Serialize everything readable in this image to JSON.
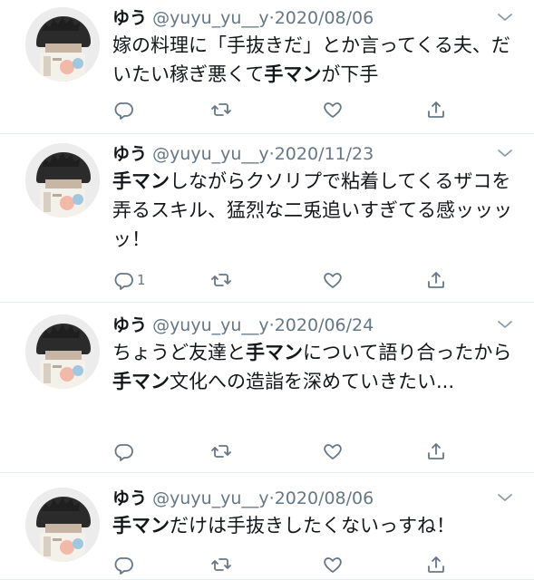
{
  "tweets": [
    {
      "name": "ゆう",
      "handle": "@yuyu_yu__y",
      "separator": "·",
      "date": "2020/08/06",
      "segments": [
        {
          "text": "嫁の料理に「手抜きだ」とか言ってくる夫、だいたい稼ぎ悪くて",
          "bold": false
        },
        {
          "text": "手マン",
          "bold": true
        },
        {
          "text": "が下手",
          "bold": false
        }
      ],
      "reply_count": ""
    },
    {
      "name": "ゆう",
      "handle": "@yuyu_yu__y",
      "separator": "·",
      "date": "2020/11/23",
      "segments": [
        {
          "text": "手マン",
          "bold": true
        },
        {
          "text": "しながらクソリプで粘着してくるザコを弄るスキル、猛烈な二兎追いすぎてる感ッッッッ！",
          "bold": false
        }
      ],
      "reply_count": "1"
    },
    {
      "name": "ゆう",
      "handle": "@yuyu_yu__y",
      "separator": "·",
      "date": "2020/06/24",
      "segments": [
        {
          "text": "ちょうど友達と",
          "bold": false
        },
        {
          "text": "手マン",
          "bold": true
        },
        {
          "text": "について語り合ったから",
          "bold": false
        },
        {
          "text": "手マン",
          "bold": true
        },
        {
          "text": "文化への造詣を深めていきたい...",
          "bold": false
        }
      ],
      "reply_count": ""
    },
    {
      "name": "ゆう",
      "handle": "@yuyu_yu__y",
      "separator": "·",
      "date": "2020/08/06",
      "segments": [
        {
          "text": "手マン",
          "bold": true
        },
        {
          "text": "だけは手抜きしたくないっすね！",
          "bold": false
        }
      ],
      "reply_count": ""
    }
  ],
  "icons": {
    "reply": "reply-icon",
    "retweet": "retweet-icon",
    "like": "heart-icon",
    "share": "share-icon",
    "menu": "chevron-down-icon"
  },
  "colors": {
    "text": "#14171a",
    "secondary": "#657786",
    "divider": "#e6ecf0"
  }
}
